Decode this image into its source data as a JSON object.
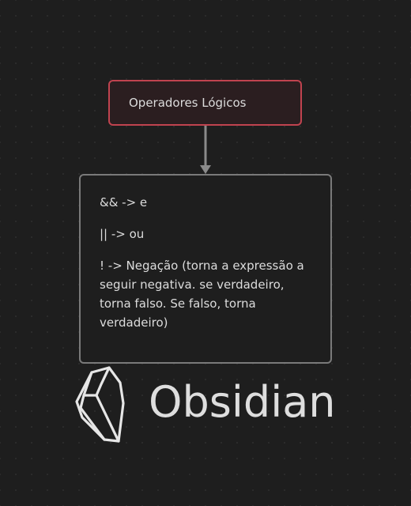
{
  "canvas": {
    "nodes": {
      "title_node": {
        "text": "Operadores Lógicos"
      },
      "content_node": {
        "lines": [
          "&& -> e",
          "|| -> ou",
          "! -> Negação (torna a expressão a seguir negativa. se verdadeiro, torna falso. Se falso, torna verdadeiro)"
        ]
      }
    }
  },
  "brand": {
    "name": "Obsidian",
    "logo_icon": "obsidian-crystal-icon"
  },
  "colors": {
    "background": "#1e1e1e",
    "title_node_border": "#c0434f",
    "content_node_border": "#7a7a7a",
    "edge": "#8a8a8a",
    "text": "#dcdcdc"
  }
}
